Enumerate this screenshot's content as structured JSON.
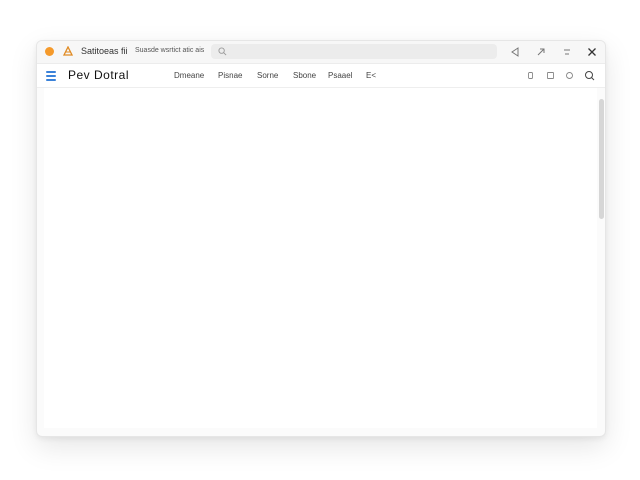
{
  "titlebar": {
    "title": "Satitoeas fii",
    "subtitle": "Suasde wsrtict atic ais",
    "search_icon": "search-icon",
    "controls": [
      "back-arrow-icon",
      "share-icon",
      "minimize-icon",
      "close-icon"
    ]
  },
  "toolbar": {
    "brand": "Pev Dotral",
    "nav": [
      {
        "label": "Dmeane"
      },
      {
        "label": "Pisnae"
      },
      {
        "label": "Sorne"
      },
      {
        "label": "Sbone"
      },
      {
        "label": "Psaael"
      },
      {
        "label": "E<"
      }
    ],
    "right_icons": [
      "info-icon",
      "square-icon",
      "settings-icon",
      "search-icon"
    ]
  },
  "colors": {
    "accent": "#3b82d9",
    "status_dot": "#f59a2b"
  }
}
